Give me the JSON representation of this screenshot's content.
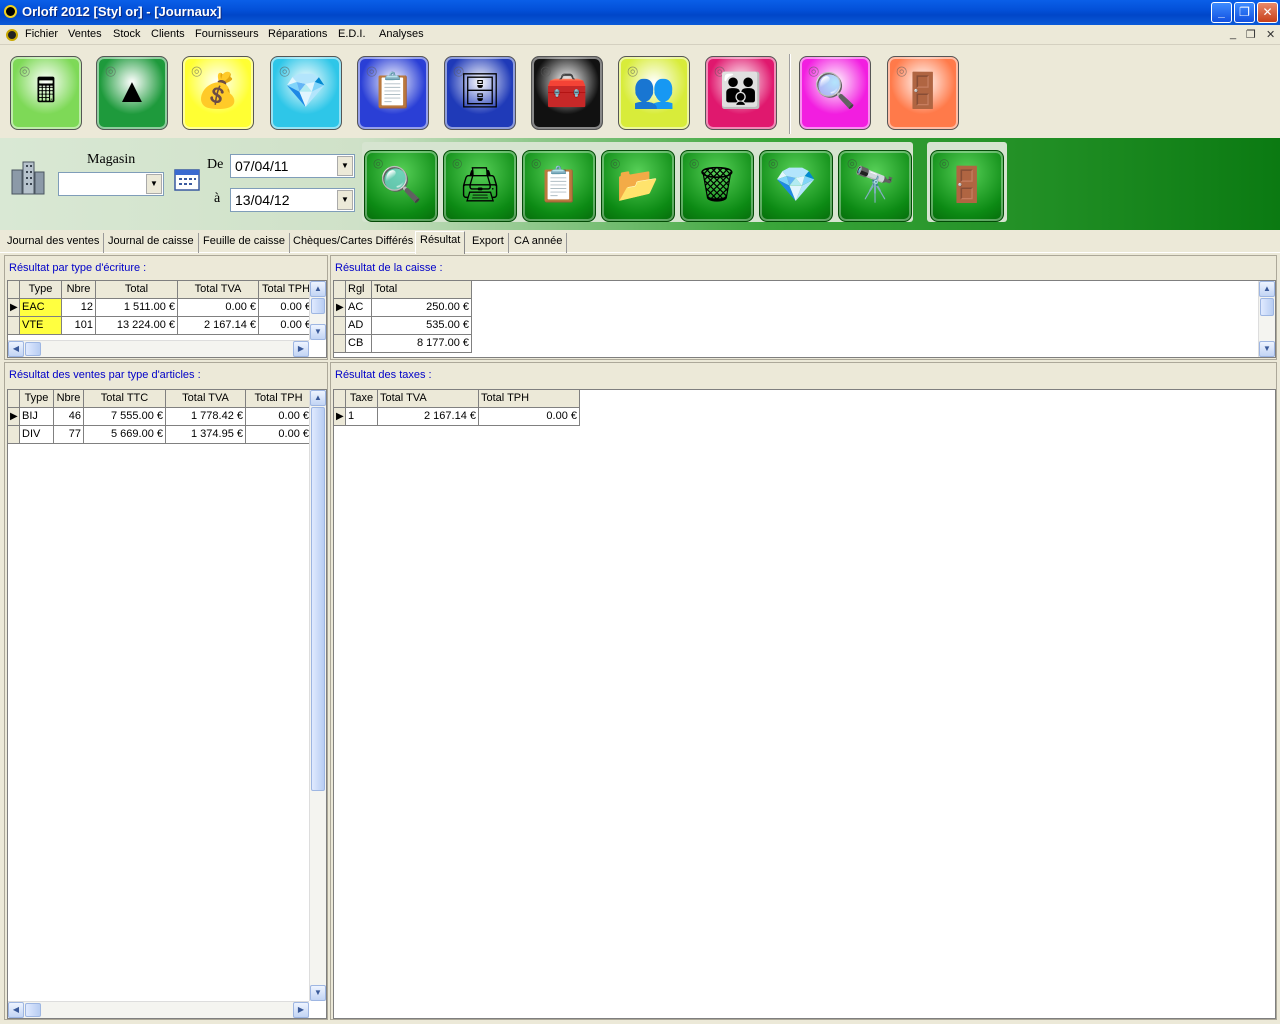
{
  "window": {
    "title": "Orloff 2012 [Styl or] - [Journaux]"
  },
  "window_controls": {
    "minimize": "_",
    "restore": "❐",
    "close": "✕"
  },
  "mdi_controls": {
    "minimize": "_",
    "restore": "❐",
    "close": "✕"
  },
  "menu": [
    "Fichier",
    "Ventes",
    "Stock",
    "Clients",
    "Fournisseurs",
    "Réparations",
    "E.D.I.",
    "Analyses"
  ],
  "toolbar": [
    {
      "icon": "cash-register-icon",
      "glyph": "🖩",
      "color": "#7ed957"
    },
    {
      "icon": "pyramid-icon",
      "glyph": "▲",
      "color": "#1e9a3c"
    },
    {
      "icon": "gold-jewelry-icon",
      "glyph": "💰",
      "color": "#ffff33"
    },
    {
      "icon": "diamond-icon",
      "glyph": "💎",
      "color": "#2ec6e8"
    },
    {
      "icon": "invoice-icon",
      "glyph": "📋",
      "color": "#2a3fd6"
    },
    {
      "icon": "safe-icon",
      "glyph": "🗄",
      "color": "#1f3ab8"
    },
    {
      "icon": "toolcase-icon",
      "glyph": "🧰",
      "color": "#111111"
    },
    {
      "icon": "clients-icon",
      "glyph": "👥",
      "color": "#d8ec3a"
    },
    {
      "icon": "suppliers-icon",
      "glyph": "👪",
      "color": "#e0186e"
    },
    {
      "icon": "analysis-icon",
      "glyph": "🔍",
      "color": "#f21ee0"
    },
    {
      "icon": "exit-door-icon",
      "glyph": "🚪",
      "color": "#ff7a4a"
    }
  ],
  "filter": {
    "magasin_label": "Magasin",
    "magasin_value": "",
    "de_label": "De",
    "a_label": "à",
    "date_from": "07/04/11",
    "date_to": "13/04/12"
  },
  "green_buttons": [
    {
      "icon": "search-icon",
      "glyph": "🔍"
    },
    {
      "icon": "printer-icon",
      "glyph": "🖨"
    },
    {
      "icon": "print-preview-icon",
      "glyph": "📋"
    },
    {
      "icon": "folder-lock-icon",
      "glyph": "📂"
    },
    {
      "icon": "shredder-icon",
      "glyph": "🗑"
    },
    {
      "icon": "diamond-search-icon",
      "glyph": "💎"
    },
    {
      "icon": "binoculars-icon",
      "glyph": "🔭"
    },
    {
      "icon": "exit-door-icon",
      "glyph": "🚪"
    }
  ],
  "tabs": [
    "Journal des ventes",
    "Journal de caisse",
    "Feuille de caisse",
    "Chèques/Cartes Différés",
    "Résultat",
    "Export",
    "CA année"
  ],
  "active_tab": "Résultat",
  "panels": {
    "by_entry_type": {
      "title": "Résultat par type d'écriture :",
      "headers": [
        "Type",
        "Nbre",
        "Total",
        "Total TVA",
        "Total TPH"
      ],
      "rows": [
        [
          "EAC",
          "12",
          "1 511.00 €",
          "0.00 €",
          "0.00 €"
        ],
        [
          "VTE",
          "101",
          "13 224.00 €",
          "2 167.14 €",
          "0.00 €"
        ]
      ]
    },
    "cash_result": {
      "title": "Résultat de la caisse :",
      "headers": [
        "Rgl",
        "Total"
      ],
      "rows": [
        [
          "AC",
          "250.00 €"
        ],
        [
          "AD",
          "535.00 €"
        ],
        [
          "CB",
          "8 177.00 €"
        ]
      ]
    },
    "sales_by_article": {
      "title": "Résultat des ventes par type d'articles :",
      "headers": [
        "Type",
        "Nbre",
        "Total TTC",
        "Total TVA",
        "Total TPH"
      ],
      "rows": [
        [
          "BIJ",
          "46",
          "7 555.00 €",
          "1 778.42 €",
          "0.00 €"
        ],
        [
          "DIV",
          "77",
          "5 669.00 €",
          "1 374.95 €",
          "0.00 €"
        ]
      ]
    },
    "taxes": {
      "title": "Résultat des taxes :",
      "headers": [
        "Taxe",
        "Total TVA",
        "Total TPH"
      ],
      "rows": [
        [
          "1",
          "2 167.14 €",
          "0.00 €"
        ]
      ]
    }
  }
}
